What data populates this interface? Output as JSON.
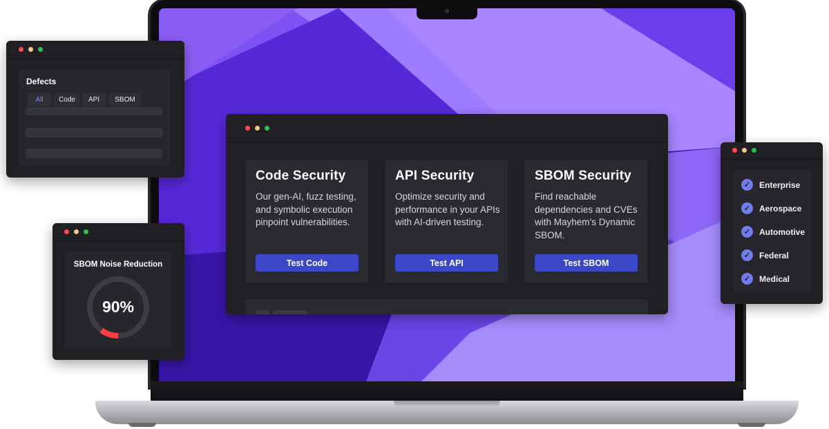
{
  "main_window": {
    "cards": [
      {
        "title": "Code Security",
        "description": "Our gen-AI, fuzz testing, and symbolic execution pinpoint vulnerabilities.",
        "button": "Test Code"
      },
      {
        "title": "API Security",
        "description": "Optimize security and performance in your APIs with AI-driven testing.",
        "button": "Test API"
      },
      {
        "title": "SBOM Security",
        "description": "Find reachable dependencies and CVEs with Mayhem’s Dynamic SBOM.",
        "button": "Test SBOM"
      }
    ]
  },
  "defects_window": {
    "title": "Defects",
    "tabs": [
      "All",
      "Code",
      "API",
      "SBOM"
    ],
    "active_tab": "All"
  },
  "sbom_window": {
    "title": "SBOM Noise Reduction",
    "percent_label": "90%",
    "gauge_fraction": 0.1
  },
  "industries_window": {
    "items": [
      "Enterprise",
      "Aerospace",
      "Automotive",
      "Federal",
      "Medical"
    ]
  },
  "colors": {
    "accent_button": "#3b47c6",
    "check_icon": "#6f7df0",
    "gauge_highlight": "#ff4040",
    "window_bg": "#1f1f24"
  }
}
